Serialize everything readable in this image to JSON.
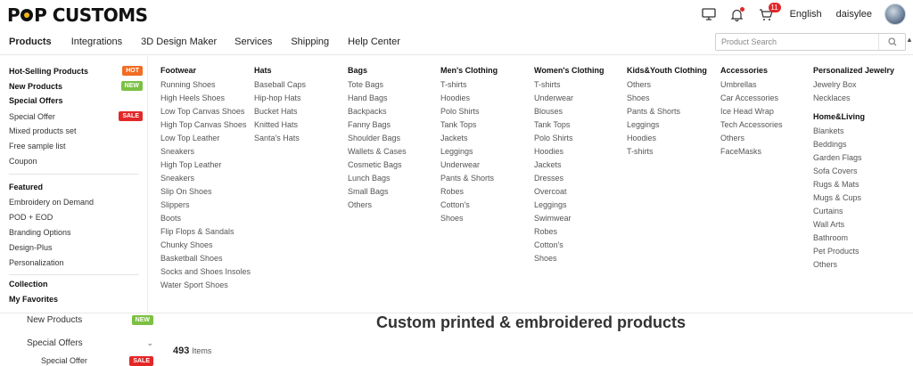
{
  "header": {
    "logo": "POPCUSTOMS",
    "language": "English",
    "username": "daisylee",
    "cart_count": "11"
  },
  "nav": {
    "items": [
      "Products",
      "Integrations",
      "3D Design Maker",
      "Services",
      "Shipping",
      "Help Center"
    ],
    "search_placeholder": "Product Search"
  },
  "left_menu": {
    "items": [
      {
        "label": "Hot-Selling Products",
        "bold": true,
        "badge": "HOT",
        "badge_color": "#f26c22"
      },
      {
        "label": "New Products",
        "bold": true,
        "badge": "NEW",
        "badge_color": "#7bc043"
      },
      {
        "label": "Special Offers",
        "bold": true
      },
      {
        "label": "Special Offer",
        "badge": "SALE",
        "badge_color": "#e32727"
      },
      {
        "label": "Mixed products set"
      },
      {
        "label": "Free sample list"
      },
      {
        "label": "Coupon"
      },
      {
        "label": "Featured",
        "bold": true
      },
      {
        "label": "Embroidery on Demand"
      },
      {
        "label": "POD + EOD"
      },
      {
        "label": "Branding Options"
      },
      {
        "label": "Design-Plus"
      },
      {
        "label": "Personalization"
      },
      {
        "label": "Collection",
        "bold": true
      },
      {
        "label": "My Favorites",
        "bold": true
      }
    ]
  },
  "columns": [
    {
      "title": "Footwear",
      "items": [
        "Running Shoes",
        "High Heels Shoes",
        "Low Top Canvas Shoes",
        "High Top Canvas Shoes",
        "Low Top Leather",
        "Sneakers",
        "High Top Leather",
        "Sneakers",
        "Slip On Shoes",
        "Slippers",
        "Boots",
        "Flip Flops & Sandals",
        "Chunky Shoes",
        "Basketball Shoes",
        "Socks and Shoes Insoles",
        "Water Sport Shoes"
      ]
    },
    {
      "title": "Hats",
      "items": [
        "Baseball Caps",
        "Hip-hop Hats",
        "Bucket Hats",
        "Knitted Hats",
        "Santa's Hats"
      ]
    },
    {
      "title": "Bags",
      "items": [
        "Tote Bags",
        "Hand Bags",
        "Backpacks",
        "Fanny Bags",
        "Shoulder Bags",
        "Wallets & Cases",
        "Cosmetic Bags",
        "Lunch Bags",
        "Small Bags",
        "Others"
      ]
    },
    {
      "title": "Men's Clothing",
      "items": [
        "T-shirts",
        "Hoodies",
        "Polo Shirts",
        "Tank Tops",
        "Jackets",
        "Leggings",
        "Underwear",
        "Pants & Shorts",
        "Robes",
        "Cotton's",
        "Shoes"
      ]
    },
    {
      "title": "Women's Clothing",
      "items": [
        "T-shirts",
        "Underwear",
        "Blouses",
        "Tank Tops",
        "Polo Shirts",
        "Hoodies",
        "Jackets",
        "Dresses",
        "Overcoat",
        "Leggings",
        "Swimwear",
        "Robes",
        "Cotton's",
        "Shoes"
      ]
    },
    {
      "title": "Kids&Youth Clothing",
      "items": [
        "Others",
        "Shoes",
        "Pants & Shorts",
        "Leggings",
        "Hoodies",
        "T-shirts"
      ]
    },
    {
      "title": "Accessories",
      "items": [
        "Umbrellas",
        "Car Accessories",
        "Ice Head Wrap",
        "Tech Accessories",
        "Others",
        "FaceMasks"
      ]
    },
    {
      "title": "Personalized Jewelry",
      "items": [
        "Jewelry Box",
        "Necklaces"
      ]
    },
    {
      "title": "Home&Living",
      "items": [
        "Blankets",
        "Beddings",
        "Garden Flags",
        "Sofa Covers",
        "Rugs & Mats",
        "Mugs & Cups",
        "Curtains",
        "Wall Arts",
        "Bathroom",
        "Pet Products",
        "Others"
      ]
    }
  ],
  "background": {
    "title": "Custom printed & embroidered products",
    "side_new": "New Products",
    "side_new_badge": "NEW",
    "side_special": "Special Offers",
    "side_special_offer": "Special Offer",
    "side_sale_badge": "SALE",
    "count": "493",
    "count_unit": "Items"
  }
}
